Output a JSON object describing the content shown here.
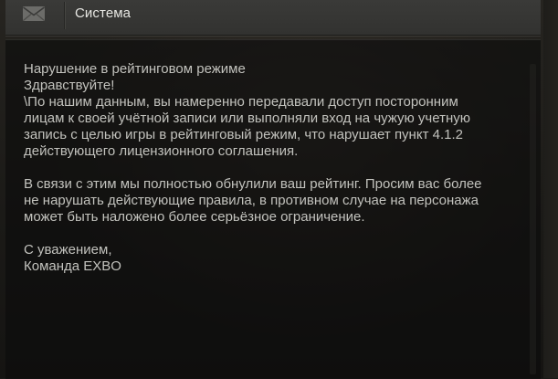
{
  "header": {
    "icon": "envelope-icon",
    "sender": "Система"
  },
  "letter": {
    "subject": "Нарушение в рейтинговом режиме",
    "greeting": "Здравствуйте!",
    "p1": [
      "\\По нашим данным, вы намеренно передавали доступ посторонним",
      "лицам к своей учётной записи или выполняли вход на чужую учетную",
      "запись с целью игры в рейтинговый режим, что нарушает пункт 4.1.2",
      "действующего лицензионного соглашения."
    ],
    "p2": [
      "В связи с этим мы полностью обнулили ваш рейтинг. Просим вас более",
      "не нарушать действующие правила, в противном случае на персонажа",
      "может быть наложено более серьёзное ограничение."
    ],
    "closing": "С уважением,",
    "signature": "Команда EXBO"
  },
  "colors": {
    "header_bg": "#363634",
    "body_bg": "#141412",
    "text": "#c2c2bd",
    "sender_text": "#e6e6e2"
  }
}
